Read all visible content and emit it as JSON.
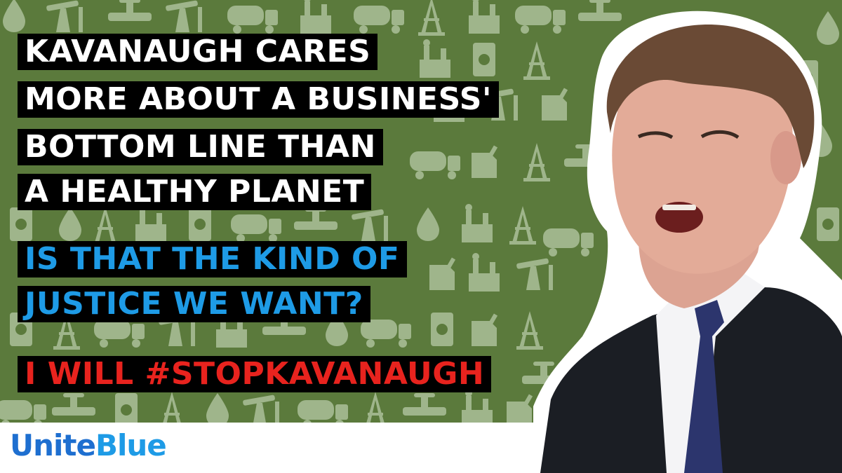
{
  "headline": {
    "lines": [
      "KAVANAUGH CARES",
      "MORE ABOUT A BUSINESS'",
      "BOTTOM LINE THAN",
      "A HEALTHY PLANET"
    ]
  },
  "question": {
    "lines": [
      "IS THAT THE KIND OF",
      "JUSTICE WE WANT?"
    ]
  },
  "call_to_action": "I WILL #STOPKAVANAUGH",
  "brand": {
    "part1": "Unite",
    "part2": "Blue"
  },
  "colors": {
    "background_green": "#5b7a3c",
    "pattern_icon": "#9fb58b",
    "headline_text": "#ffffff",
    "question_text": "#1e9be6",
    "cta_text": "#e8231e",
    "brand_unite": "#1e6fd0",
    "brand_blue": "#1e9be6"
  },
  "icons": [
    "oil-pump-icon",
    "fuel-truck-icon",
    "oil-drop-icon",
    "radiation-barrel-icon",
    "factory-icon",
    "pipe-valve-icon",
    "oil-derrick-icon",
    "gas-can-icon"
  ]
}
